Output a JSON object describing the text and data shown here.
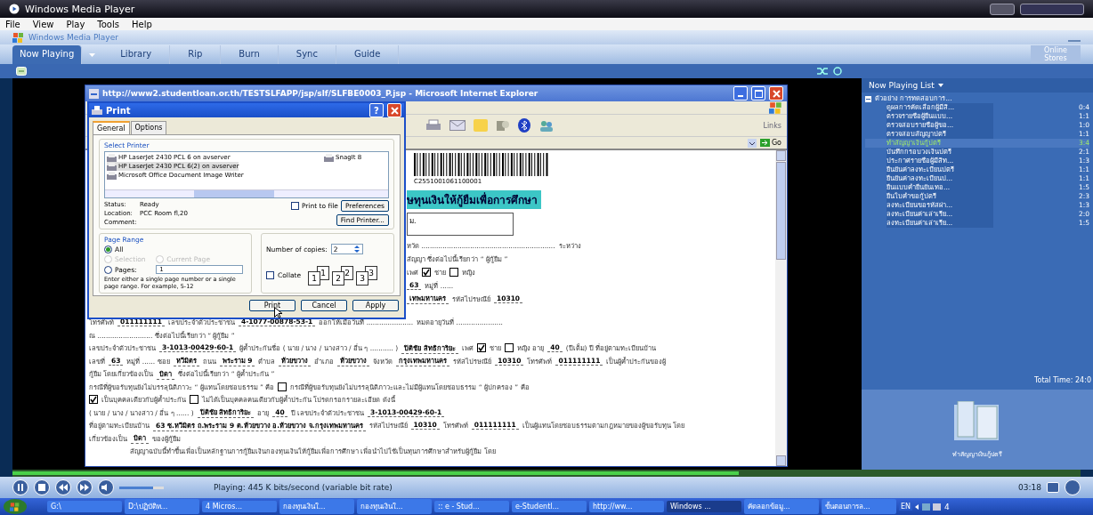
{
  "window": {
    "title": "Windows Media Player"
  },
  "menu": [
    "File",
    "View",
    "Play",
    "Tools",
    "Help"
  ],
  "player_title": "Windows Media Player",
  "tabs": [
    {
      "label": "Now Playing",
      "selected": true
    },
    {
      "label": "Library",
      "selected": false
    },
    {
      "label": "Rip",
      "selected": false
    },
    {
      "label": "Burn",
      "selected": false
    },
    {
      "label": "Sync",
      "selected": false
    },
    {
      "label": "Guide",
      "selected": false
    }
  ],
  "online_stores": "Online Stores",
  "browser": {
    "title": "http://www2.studentloan.or.th/TESTSLFAPP/jsp/slf/SLFBE0003_P.jsp - Microsoft Internet Explorer",
    "links": "Links",
    "go": "Go",
    "document": {
      "barcode_number": "C2551001061100001",
      "heading": "ษทุนเงินให้กู้ยืมเพื่อการศึกษา",
      "box_text": "ม.",
      "top_lines": [
        [
          {
            "kind": "text",
            "text": "หวัด ..............................................................."
          },
          {
            "kind": "text",
            "text": "ระหว่าง"
          }
        ],
        [
          {
            "kind": "text",
            "text": "สัญญา ซึ่งต่อไปนี้เรียกว่า “ ผู้กู้ยืม ”"
          }
        ],
        [
          {
            "kind": "text",
            "text": "เพศ"
          },
          {
            "kind": "checkbox",
            "checked": true
          },
          {
            "kind": "text",
            "text": "ชาย"
          },
          {
            "kind": "checkbox",
            "checked": false
          },
          {
            "kind": "text",
            "text": "หญิง"
          }
        ],
        [
          {
            "kind": "value",
            "text": "63"
          },
          {
            "kind": "text",
            "text": "หมู่ที่ ......"
          }
        ],
        [
          {
            "kind": "value",
            "text": "เทพมหานคร"
          },
          {
            "kind": "text",
            "text": "รหัสไปรษณีย์"
          },
          {
            "kind": "value",
            "text": "10310"
          }
        ]
      ],
      "lines": [
        [
          {
            "kind": "text",
            "text": "โทรศัพท์"
          },
          {
            "kind": "value",
            "text": "011111111"
          },
          {
            "kind": "text",
            "text": "เลขประจำตัวประชาชน"
          },
          {
            "kind": "value",
            "text": "4-1077-00878-53-1"
          },
          {
            "kind": "text",
            "text": "ออกให้เมื่อวันที่ ......................"
          },
          {
            "kind": "text",
            "text": "หมดอายุวันที่ ......................"
          }
        ],
        [
          {
            "kind": "text",
            "text": "ณ .......................... ซึ่งต่อไปนี้เรียกว่า “ ผู้กู้ยืม ”"
          }
        ],
        [
          {
            "kind": "text",
            "text": "เลขประจำตัวประชาชน"
          },
          {
            "kind": "value",
            "text": "3-1013-00429-60-1"
          },
          {
            "kind": "text",
            "text": "ผู้ค้ำประกันชื่อ ( นาย / นาง / นางสาว / อื่น ๆ ........... )"
          },
          {
            "kind": "value",
            "text": "ปิติชัย สิทธิการิยะ"
          },
          {
            "kind": "text",
            "text": "เพศ"
          },
          {
            "kind": "checkbox",
            "checked": true
          },
          {
            "kind": "text",
            "text": "ชาย"
          },
          {
            "kind": "checkbox",
            "checked": false
          },
          {
            "kind": "text",
            "text": "หญิง อายุ"
          },
          {
            "kind": "value",
            "text": "40"
          },
          {
            "kind": "text",
            "text": "(ปีเต็ม) ปี ที่อยู่ตามทะเบียนบ้าน"
          }
        ],
        [
          {
            "kind": "text",
            "text": "เลขที่"
          },
          {
            "kind": "value",
            "text": "63"
          },
          {
            "kind": "text",
            "text": "หมู่ที่ ...... ซอย"
          },
          {
            "kind": "value",
            "text": "หวีมิตร"
          },
          {
            "kind": "text",
            "text": "ถนน"
          },
          {
            "kind": "value",
            "text": "พระราม 9"
          },
          {
            "kind": "text",
            "text": "ตำบล"
          },
          {
            "kind": "value",
            "text": "ห้วยขวาง"
          },
          {
            "kind": "text",
            "text": "อำเภอ"
          },
          {
            "kind": "value",
            "text": "ห้วยขวาง"
          },
          {
            "kind": "text",
            "text": "จังหวัด"
          },
          {
            "kind": "value",
            "text": "กรุงเทพมหานคร"
          },
          {
            "kind": "text",
            "text": "รหัสไปรษณีย์"
          },
          {
            "kind": "value",
            "text": "10310"
          },
          {
            "kind": "text",
            "text": "โทรศัพท์"
          },
          {
            "kind": "value",
            "text": "011111111"
          },
          {
            "kind": "text",
            "text": "เป็นผู้ค้ำประกันของผู้"
          }
        ],
        [
          {
            "kind": "text",
            "text": "กู้ยืม โดยเกี่ยวข้องเป็น"
          },
          {
            "kind": "value",
            "text": "บิดา"
          },
          {
            "kind": "text",
            "text": "ซึ่งต่อไปนี้เรียกว่า “ ผู้ค้ำประกัน ”"
          }
        ],
        [
          {
            "kind": "text",
            "text": "กรณีที่ผู้ขอรับทุนยังไม่บรรลุนิติภาวะ “ ผู้แทนโดยชอบธรรม ” คือ"
          },
          {
            "kind": "checkbox",
            "checked": false
          },
          {
            "kind": "text",
            "text": "กรณีที่ผู้ขอรับทุนยังไม่บรรลุนิติภาวะและไม่มีผู้แทนโดยชอบธรรม “ ผู้ปกครอง ” คือ"
          }
        ],
        [
          {
            "kind": "checkbox",
            "checked": true
          },
          {
            "kind": "text",
            "text": "เป็นบุคคลเดียวกับผู้ค้ำประกัน"
          },
          {
            "kind": "checkbox",
            "checked": false
          },
          {
            "kind": "text",
            "text": "ไม่ได้เป็นบุคคลคนเดียวกับผู้ค้ำประกัน โปรดกรอกรายละเอียด ดังนี้"
          }
        ],
        [
          {
            "kind": "text",
            "text": "( นาย / นาง / นางสาว / อื่น ๆ ...... )"
          },
          {
            "kind": "value",
            "text": "ปิติชัย สิทธิการิยะ"
          },
          {
            "kind": "text",
            "text": "อายุ"
          },
          {
            "kind": "value",
            "text": "40"
          },
          {
            "kind": "text",
            "text": "ปี เลขประจำตัวประชาชน"
          },
          {
            "kind": "value",
            "text": "3-1013-00429-60-1"
          }
        ],
        [
          {
            "kind": "text",
            "text": "ที่อยู่ตามทะเบียนบ้าน"
          },
          {
            "kind": "value",
            "text": "63 ซ.หวีมิตร ถ.พระราม 9 ต.ห้วยขวาง อ.ห้วยขวาง จ.กรุงเทพมหานคร"
          },
          {
            "kind": "text",
            "text": "รหัสไปรษณีย์"
          },
          {
            "kind": "value",
            "text": "10310"
          },
          {
            "kind": "text",
            "text": "โทรศัพท์"
          },
          {
            "kind": "value",
            "text": "011111111"
          },
          {
            "kind": "text",
            "text": "เป็นผู้แทนโดยชอบธรรมตามกฎหมายของผู้ขอรับทุน โดย"
          }
        ],
        [
          {
            "kind": "text",
            "text": "เกี่ยวข้องเป็น"
          },
          {
            "kind": "value",
            "text": "บิดา"
          },
          {
            "kind": "text",
            "text": "ของผู้กู้ยืม"
          }
        ],
        [
          {
            "kind": "text",
            "text": "สัญญาฉบับนี้ทำขึ้นเพื่อเป็นหลักฐานการกู้ยืมเงินกองทุนเงินให้กู้ยืมเพื่อการศึกษา เพื่อนำไปใช้เป็นทุนการศึกษาสำหรับผู้กู้ยืม โดย"
          }
        ]
      ]
    }
  },
  "print_dialog": {
    "title": "Print",
    "help_button": "?",
    "tabs": [
      {
        "label": "General",
        "selected": true
      },
      {
        "label": "Options",
        "selected": false
      }
    ],
    "select_printer_label": "Select Printer",
    "printers": [
      {
        "name": "HP LaserJet 2430 PCL 6 on avserver",
        "selected": false
      },
      {
        "name": "HP LaserJet 2430 PCL 6(2) on avserver",
        "selected": true
      },
      {
        "name": "Microsoft Office Document Image Writer",
        "selected": false
      },
      {
        "name": "SnagIt 8",
        "selected": false
      }
    ],
    "status": [
      {
        "label": "Status:",
        "value": "Ready"
      },
      {
        "label": "Location:",
        "value": "PCC Room fl,20"
      },
      {
        "label": "Comment:"
      }
    ],
    "print_to_file": {
      "label": "Print to file",
      "checked": false
    },
    "preferences": "Preferences",
    "find_printer": "Find Printer...",
    "page_range_label": "Page Range",
    "ranges": [
      {
        "label": "All",
        "selected": true,
        "disabled": false
      },
      {
        "label": "Selection",
        "selected": false,
        "disabled": true
      },
      {
        "label": "Current Page",
        "selected": false,
        "disabled": true
      },
      {
        "label": "Pages:",
        "selected": false,
        "disabled": false
      }
    ],
    "pages_value": "1",
    "hint": "Enter either a single page number or a single page range.  For example, 5-12",
    "copies_label": "Number of copies:",
    "copies_value": "2",
    "collate": {
      "label": "Collate",
      "checked": false
    },
    "collate_icons": [
      [
        "1",
        "1"
      ],
      [
        "2",
        "2"
      ],
      [
        "3",
        "3"
      ]
    ],
    "buttons": [
      "Print",
      "Cancel",
      "Apply"
    ]
  },
  "playlist": {
    "header": "Now Playing List",
    "group": {
      "title": "ตัวอย่าง การทดสอบการ...",
      "expanded": true,
      "children": [
        {
          "title": "ดูผลการคัดเลือกผู้มีสิ...",
          "duration": "0:4",
          "selected": false
        },
        {
          "title": "ตรวจรายชื่อผู้ยื่นแบบ...",
          "duration": "1:1",
          "selected": false
        },
        {
          "title": "ตรวจสอบรายชื่อผู้ขอ...",
          "duration": "1:0",
          "selected": false
        },
        {
          "title": "ตรวจสอบสัญญาปตรี",
          "duration": "1:1",
          "selected": false
        },
        {
          "title": "ทำสัญญาเงินกู้ปตรี",
          "duration": "3:4",
          "selected": true
        },
        {
          "title": "บันทึกกรอบวงเงินปตรี",
          "duration": "2:1",
          "selected": false
        },
        {
          "title": "ประกาศรายชื่อผู้มีสิท...",
          "duration": "1:3",
          "selected": false
        },
        {
          "title": "ยืนยันค่าลงทะเบียนปตรี",
          "duration": "1:1",
          "selected": false
        },
        {
          "title": "ยืนยันค่าลงทะเบียนป...",
          "duration": "1:1",
          "selected": false
        },
        {
          "title": "ยื่นแบบคำยืนยันเทอ...",
          "duration": "1:5",
          "selected": false
        },
        {
          "title": "ยื่นใบคำขอกู้ปตรี",
          "duration": "2:3",
          "selected": false
        },
        {
          "title": "ลงทะเบียนขอรหัสผ่า...",
          "duration": "1:3",
          "selected": false
        },
        {
          "title": "ลงทะเบียนค่าเล่าเรีย...",
          "duration": "2:0",
          "selected": false
        },
        {
          "title": "ลงทะเบียนค่าเล่าเรีย...",
          "duration": "1:5",
          "selected": false
        }
      ]
    },
    "total_time": "Total Time: 24:0",
    "album_caption": "ทำสัญญาเงินกู้ปตรี"
  },
  "player": {
    "seek": {
      "level": 0.68
    },
    "volume": {
      "level": 0.75
    },
    "status": "Playing: 445 K bits/second (variable bit rate)",
    "time": "03:18"
  },
  "taskbar": {
    "items": [
      {
        "label": "G:\\",
        "selected": false
      },
      {
        "label": "D:\\ปฏิบัติห...",
        "selected": false
      },
      {
        "label": "4 Micros...",
        "selected": false
      },
      {
        "label": "กองทุนเงินใ...",
        "selected": false
      },
      {
        "label": "กองทุนเงินใ...",
        "selected": false
      },
      {
        "label": ":: e - Stud...",
        "selected": false
      },
      {
        "label": "e-Studentl...",
        "selected": false
      },
      {
        "label": "http://ww...",
        "selected": false
      },
      {
        "label": "Windows ...",
        "selected": true
      },
      {
        "label": "คัดลอกข้อมู...",
        "selected": false
      },
      {
        "label": "ขั้นตอนการล...",
        "selected": false
      }
    ],
    "language": "EN",
    "clock": "4"
  }
}
